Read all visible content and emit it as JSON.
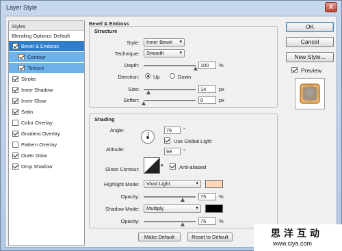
{
  "window": {
    "title": "Layer Style",
    "close_label": "X"
  },
  "styles_panel": {
    "header": "Styles",
    "blending_options": "Blending Options: Default",
    "items": [
      {
        "label": "Bevel & Emboss",
        "checked": true,
        "selected": true
      },
      {
        "label": "Contour",
        "checked": true,
        "sub": true
      },
      {
        "label": "Texture",
        "checked": true,
        "sub": true
      },
      {
        "label": "Stroke",
        "checked": true
      },
      {
        "label": "Inner Shadow",
        "checked": true
      },
      {
        "label": "Inner Glow",
        "checked": true
      },
      {
        "label": "Satin",
        "checked": true
      },
      {
        "label": "Color Overlay",
        "checked": false
      },
      {
        "label": "Gradient Overlay",
        "checked": true
      },
      {
        "label": "Pattern Overlay",
        "checked": false
      },
      {
        "label": "Outer Glow",
        "checked": true
      },
      {
        "label": "Drop Shadow",
        "checked": true
      }
    ]
  },
  "bevel": {
    "title": "Bevel & Emboss",
    "structure": {
      "title": "Structure",
      "style_label": "Style:",
      "style_value": "Inner Bevel",
      "technique_label": "Technique:",
      "technique_value": "Smooth",
      "depth_label": "Depth:",
      "depth_value": "100",
      "depth_unit": "%",
      "depth_slider": 1.0,
      "direction_label": "Direction:",
      "dir_up": "Up",
      "dir_down": "Down",
      "size_label": "Size:",
      "size_value": "14",
      "size_unit": "px",
      "size_slider": 0.09,
      "soften_label": "Soften:",
      "soften_value": "0",
      "soften_unit": "px",
      "soften_slider": 0.0
    },
    "shading": {
      "title": "Shading",
      "angle_label": "Angle:",
      "angle_value": "76",
      "angle_unit": "°",
      "global_light": "Use Global Light",
      "altitude_label": "Altitude:",
      "altitude_value": "69",
      "altitude_unit": "°",
      "gloss_label": "Gloss Contour:",
      "anti_aliased": "Anti-aliased",
      "highlight_label": "Highlight Mode:",
      "highlight_value": "Vivid Light",
      "highlight_color": "#ffd9b3",
      "opacity1_label": "Opacity:",
      "opacity1_value": "75",
      "opacity1_unit": "%",
      "opacity1_slider": 0.75,
      "shadow_label": "Shadow Mode:",
      "shadow_value": "Multiply",
      "shadow_color": "#000000",
      "opacity2_label": "Opacity:",
      "opacity2_value": "75",
      "opacity2_unit": "%",
      "opacity2_slider": 0.75
    },
    "make_default": "Make Default",
    "reset_default": "Reset to Default"
  },
  "buttons": {
    "ok": "OK",
    "cancel": "Cancel",
    "new_style": "New Style...",
    "preview": "Preview"
  },
  "watermark": {
    "chinese": "思洋互动",
    "url": "www.ciya.com"
  }
}
